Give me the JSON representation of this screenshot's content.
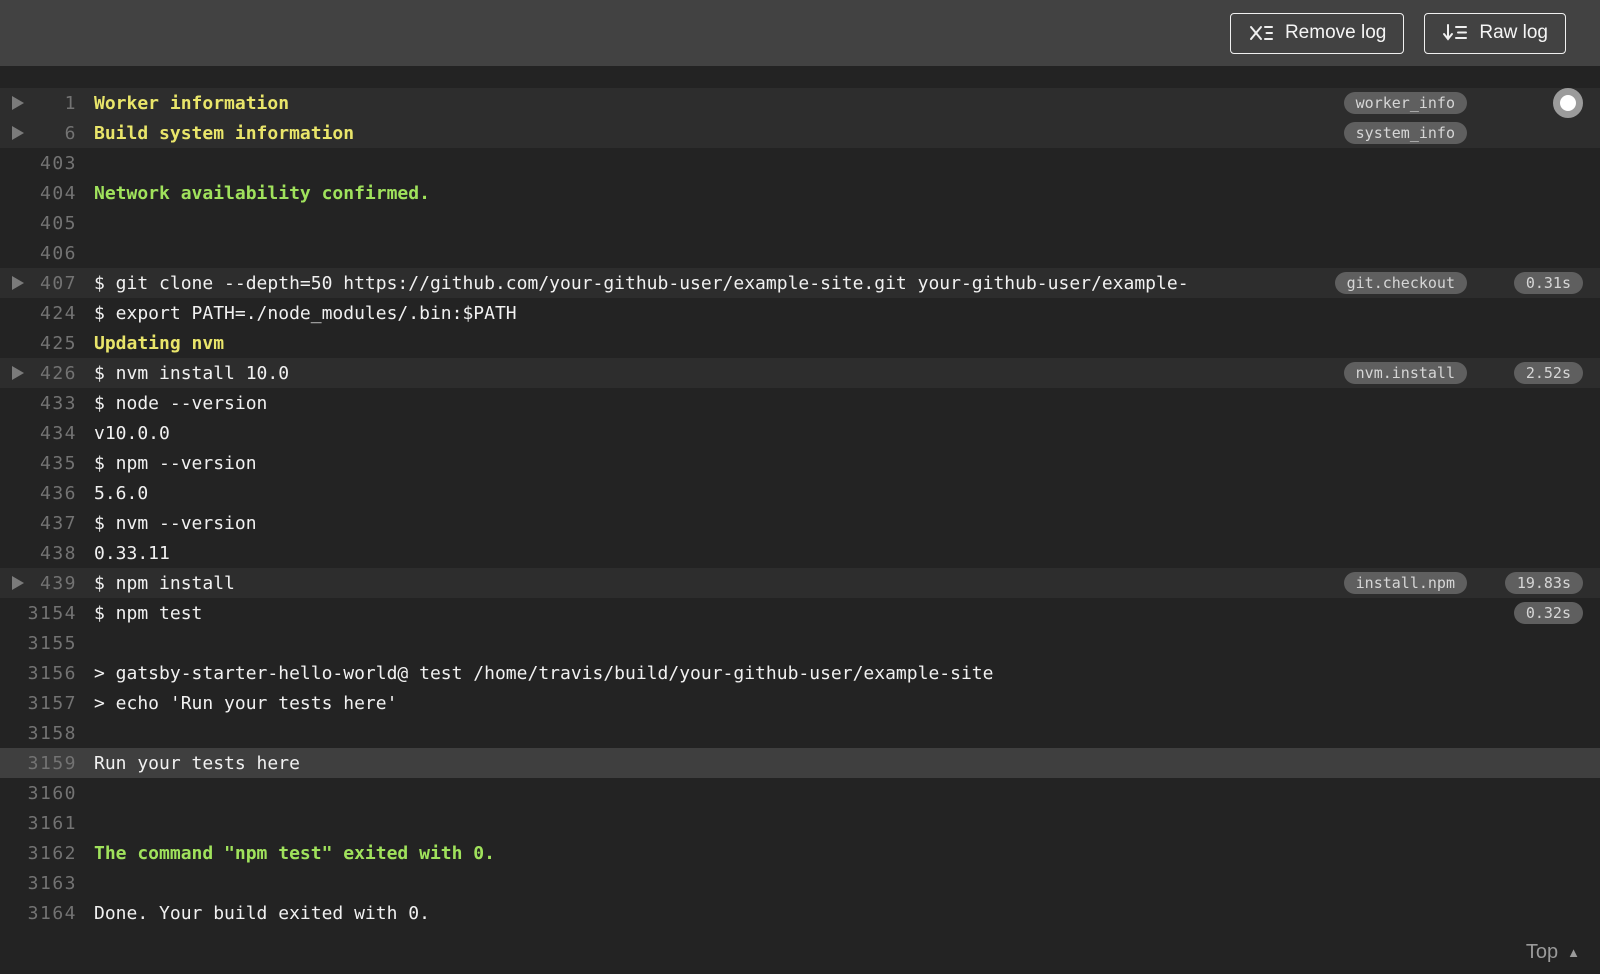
{
  "colors": {
    "toolbar-bg": "#424242",
    "log-bg": "#232323",
    "fold-row-bg": "#2d2d2d",
    "highlight-row-bg": "#3f3f3f",
    "line-num": "#737373",
    "log-text": "#f1f1f1",
    "yellow": "#e9e56a",
    "green": "#a0e25c",
    "pill-bg": "#5f5f5f",
    "pill-text": "#d6d6d6"
  },
  "toolbar": {
    "remove_log_label": "Remove log",
    "raw_log_label": "Raw log"
  },
  "footer": {
    "top_label": "Top"
  },
  "log": {
    "rows": [
      {
        "num": "1",
        "text": "Worker information",
        "style": "yellow",
        "fold": true,
        "tag": "worker_info",
        "scroll_toggle": true
      },
      {
        "num": "6",
        "text": "Build system information",
        "style": "yellow",
        "fold": true,
        "tag": "system_info"
      },
      {
        "num": "403",
        "text": ""
      },
      {
        "num": "404",
        "text": "Network availability confirmed.",
        "style": "green"
      },
      {
        "num": "405",
        "text": ""
      },
      {
        "num": "406",
        "text": ""
      },
      {
        "num": "407",
        "text": "$ git clone --depth=50 https://github.com/your-github-user/example-site.git your-github-user/example-",
        "fold": true,
        "tag": "git.checkout",
        "time": "0.31s"
      },
      {
        "num": "424",
        "text": "$ export PATH=./node_modules/.bin:$PATH"
      },
      {
        "num": "425",
        "text": "Updating nvm",
        "style": "yellow"
      },
      {
        "num": "426",
        "text": "$ nvm install 10.0",
        "fold": true,
        "tag": "nvm.install",
        "time": "2.52s"
      },
      {
        "num": "433",
        "text": "$ node --version"
      },
      {
        "num": "434",
        "text": "v10.0.0"
      },
      {
        "num": "435",
        "text": "$ npm --version"
      },
      {
        "num": "436",
        "text": "5.6.0"
      },
      {
        "num": "437",
        "text": "$ nvm --version"
      },
      {
        "num": "438",
        "text": "0.33.11"
      },
      {
        "num": "439",
        "text": "$ npm install",
        "fold": true,
        "tag": "install.npm",
        "time": "19.83s"
      },
      {
        "num": "3154",
        "text": "$ npm test",
        "time": "0.32s"
      },
      {
        "num": "3155",
        "text": ""
      },
      {
        "num": "3156",
        "text": "> gatsby-starter-hello-world@ test /home/travis/build/your-github-user/example-site"
      },
      {
        "num": "3157",
        "text": "> echo 'Run your tests here'"
      },
      {
        "num": "3158",
        "text": ""
      },
      {
        "num": "3159",
        "text": "Run your tests here",
        "highlight": true
      },
      {
        "num": "3160",
        "text": ""
      },
      {
        "num": "3161",
        "text": ""
      },
      {
        "num": "3162",
        "text": "The command \"npm test\" exited with 0.",
        "style": "green"
      },
      {
        "num": "3163",
        "text": ""
      },
      {
        "num": "3164",
        "text": "Done. Your build exited with 0."
      }
    ]
  }
}
